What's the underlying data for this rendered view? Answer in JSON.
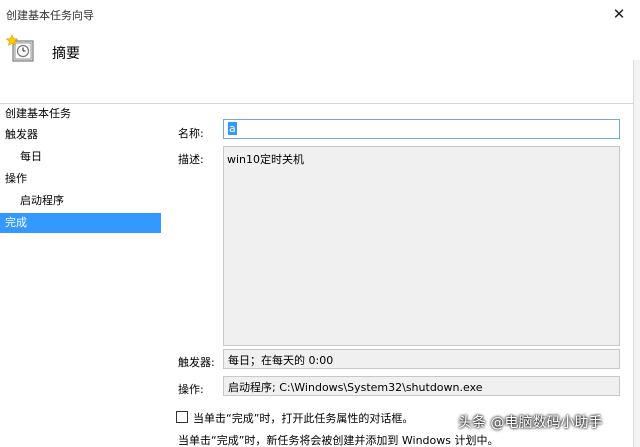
{
  "window": {
    "title": "创建基本任务向导",
    "close_glyph": "✕"
  },
  "header": {
    "title": "摘要",
    "icon": "task-wizard-icon"
  },
  "nav": {
    "items": [
      {
        "label": "创建基本任务",
        "level": "top",
        "active": false
      },
      {
        "label": "触发器",
        "level": "top",
        "active": false
      },
      {
        "label": "每日",
        "level": "sub",
        "active": false
      },
      {
        "label": "操作",
        "level": "top",
        "active": false
      },
      {
        "label": "启动程序",
        "level": "sub",
        "active": false
      },
      {
        "label": "完成",
        "level": "top",
        "active": true
      }
    ]
  },
  "form": {
    "name_label": "名称:",
    "name_value": "a",
    "description_label": "描述:",
    "description_value": "win10定时关机",
    "trigger_label": "触发器:",
    "trigger_value": "每日；在每天的 0:00",
    "action_label": "操作:",
    "action_value": "启动程序; C:\\Windows\\System32\\shutdown.exe"
  },
  "footer": {
    "checkbox_label": "当单击“完成”时，打开此任务属性的对话框。",
    "checkbox_checked": false,
    "note": "当单击“完成”时，新任务将会被创建并添加到 Windows 计划中。"
  },
  "watermark": {
    "text": "头条 @电脑数码小助手"
  },
  "colors": {
    "accent": "#3399ff",
    "field_border": "#adadad",
    "readonly_bg": "#f0f0f0"
  }
}
